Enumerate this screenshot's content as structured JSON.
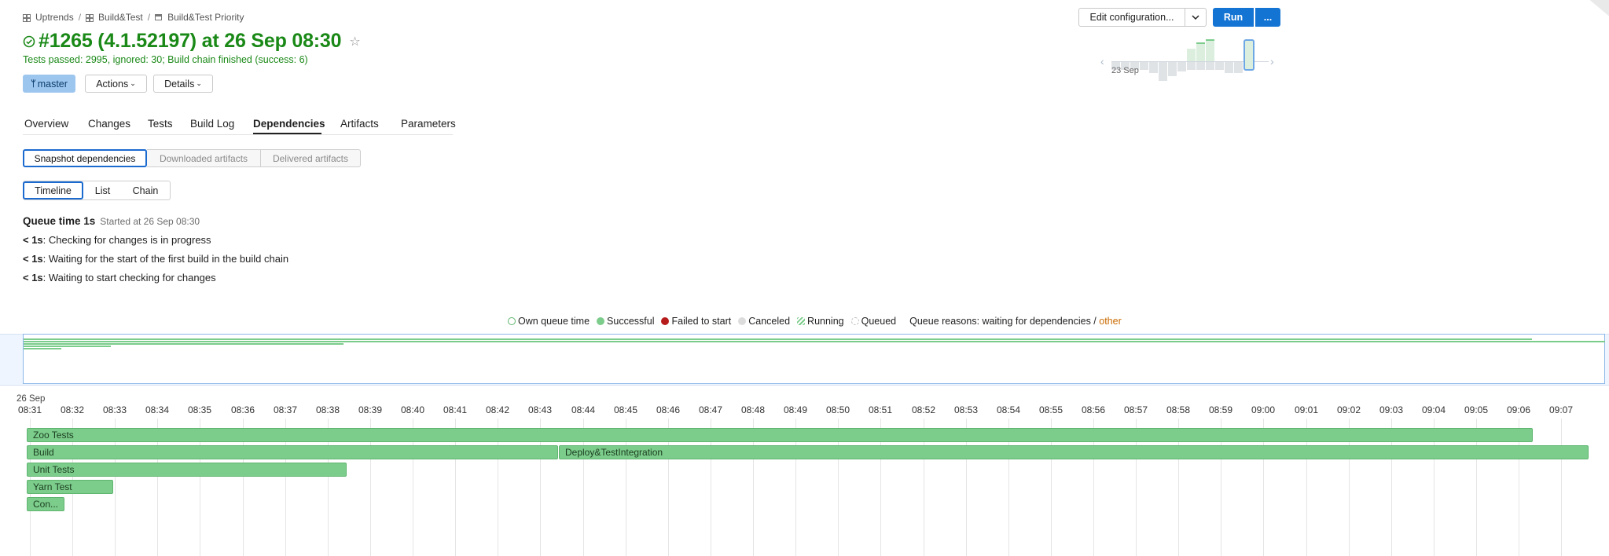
{
  "breadcrumb": {
    "items": [
      "Uptrends",
      "Build&Test",
      "Build&Test Priority"
    ],
    "separator": "/"
  },
  "build": {
    "title": "#1265 (4.1.52197) at 26 Sep 08:30",
    "star": "☆",
    "status_line": "Tests passed: 2995, ignored: 30; Build chain finished (success: 6)",
    "status_icon": "check-circle-icon"
  },
  "buttons": {
    "branch": "master",
    "actions": "Actions",
    "details": "Details",
    "edit_configuration": "Edit configuration...",
    "run": "Run",
    "run_more": "..."
  },
  "history": {
    "date_label": "23 Sep",
    "prev": "‹",
    "next": "›"
  },
  "tabs": [
    "Overview",
    "Changes",
    "Tests",
    "Build Log",
    "Dependencies",
    "Artifacts",
    "Parameters"
  ],
  "active_tab": "Dependencies",
  "dependency_types": {
    "snapshot": "Snapshot dependencies",
    "downloaded": "Downloaded artifacts",
    "delivered": "Delivered artifacts"
  },
  "views": {
    "timeline": "Timeline",
    "list": "List",
    "chain": "Chain"
  },
  "queue": {
    "head": "Queue time 1s",
    "started": "Started at 26 Sep 08:30",
    "lines": [
      {
        "dur": "< 1s",
        "text": ": Checking for changes is in progress"
      },
      {
        "dur": "< 1s",
        "text": ": Waiting for the start of the first build in the build chain"
      },
      {
        "dur": "< 1s",
        "text": ": Waiting to start checking for changes"
      }
    ]
  },
  "legend": {
    "own_queue": "Own queue time",
    "successful": "Successful",
    "failed": "Failed to start",
    "canceled": "Canceled",
    "running": "Running",
    "queued": "Queued",
    "reasons_prefix": "Queue reasons: waiting for dependencies /",
    "reasons_other": "other"
  },
  "colors": {
    "success": "#7ccc8b",
    "title_green": "#1a8917",
    "failed": "#b71c1c",
    "accent_blue": "#1474d4",
    "other_orange": "#c96a00"
  },
  "timeline": {
    "date": "26 Sep",
    "ticks": [
      "08:31",
      "08:32",
      "08:33",
      "08:34",
      "08:35",
      "08:36",
      "08:37",
      "08:38",
      "08:39",
      "08:40",
      "08:41",
      "08:42",
      "08:43",
      "08:44",
      "08:45",
      "08:46",
      "08:47",
      "08:48",
      "08:49",
      "08:50",
      "08:51",
      "08:52",
      "08:53",
      "08:54",
      "08:55",
      "08:56",
      "08:57",
      "08:58",
      "08:59",
      "09:00",
      "09:01",
      "09:02",
      "09:03",
      "09:04",
      "09:05",
      "09:06",
      "09:07"
    ],
    "builds": [
      {
        "label": "Zoo Tests",
        "start": "08:30:56",
        "end": "09:06:20",
        "row": 0
      },
      {
        "label": "Build",
        "start": "08:30:56",
        "end": "08:43:25",
        "row": 1
      },
      {
        "label": "Deploy&TestIntegration",
        "start": "08:43:26",
        "end": "09:07:38",
        "row": 1
      },
      {
        "label": "Unit Tests",
        "start": "08:30:56",
        "end": "08:38:27",
        "row": 2
      },
      {
        "label": "Yarn Test",
        "start": "08:30:56",
        "end": "08:32:58",
        "row": 3
      },
      {
        "label": "Con...",
        "start": "08:30:56",
        "end": "08:31:49",
        "row": 4
      }
    ]
  }
}
